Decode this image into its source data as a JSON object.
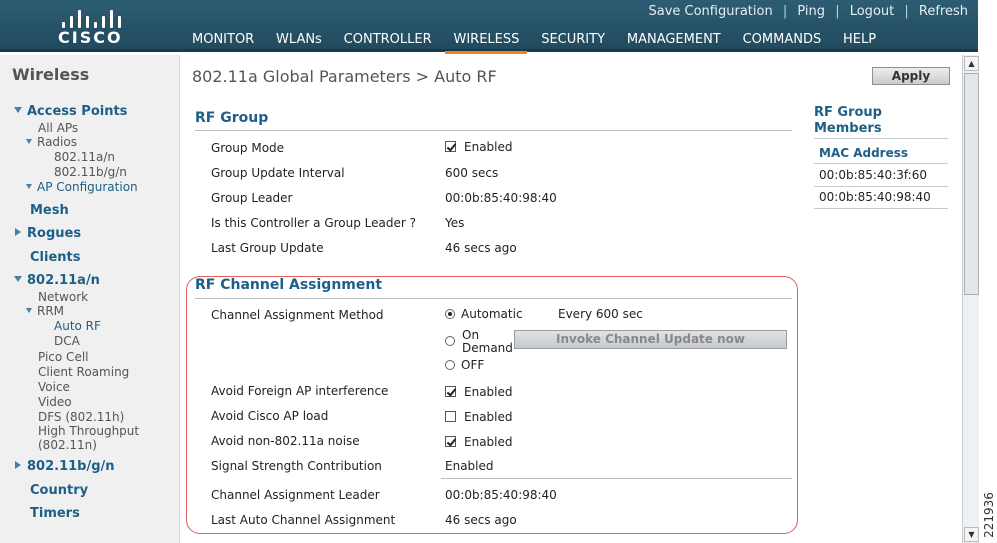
{
  "header": {
    "logo_text": "CISCO",
    "top_links": [
      "Save Configuration",
      "Ping",
      "Logout",
      "Refresh"
    ],
    "nav": [
      "MONITOR",
      "WLANs",
      "CONTROLLER",
      "WIRELESS",
      "SECURITY",
      "MANAGEMENT",
      "COMMANDS",
      "HELP"
    ],
    "active_nav": "WIRELESS"
  },
  "sidebar": {
    "title": "Wireless",
    "access_points": "Access Points",
    "all_aps": "All APs",
    "radios": "Radios",
    "radio_a": "802.11a/n",
    "radio_bg": "802.11b/g/n",
    "ap_config": "AP Configuration",
    "mesh": "Mesh",
    "rogues": "Rogues",
    "clients": "Clients",
    "a_n": "802.11a/n",
    "network": "Network",
    "rrm": "RRM",
    "auto_rf": "Auto RF",
    "dca": "DCA",
    "pico_cell": "Pico Cell",
    "client_roaming": "Client Roaming",
    "voice": "Voice",
    "video": "Video",
    "dfs": "DFS (802.11h)",
    "ht1": "High Throughput",
    "ht2": "(802.11n)",
    "bg_n": "802.11b/g/n",
    "country": "Country",
    "timers": "Timers"
  },
  "page": {
    "title": "802.11a Global Parameters > Auto RF",
    "apply": "Apply"
  },
  "rf_group": {
    "heading": "RF Group",
    "group_mode_label": "Group Mode",
    "group_mode_value": "Enabled",
    "update_interval_label": "Group Update Interval",
    "update_interval_value": "600 secs",
    "leader_label": "Group Leader",
    "leader_value": "00:0b:85:40:98:40",
    "is_leader_label": "Is this Controller a Group Leader ?",
    "is_leader_value": "Yes",
    "last_update_label": "Last Group Update",
    "last_update_value": "46 secs ago"
  },
  "channel": {
    "heading": "RF Channel Assignment",
    "method_label": "Channel Assignment Method",
    "automatic": "Automatic",
    "every": "Every 600 sec",
    "on": "On",
    "demand": "Demand",
    "off": "OFF",
    "invoke": "Invoke Channel Update now",
    "foreign_label": "Avoid Foreign AP interference",
    "foreign_value": "Enabled",
    "cisco_load_label": "Avoid Cisco AP load",
    "cisco_load_value": "Enabled",
    "noise_label": "Avoid non-802.11a noise",
    "noise_value": "Enabled",
    "signal_label": "Signal Strength Contribution",
    "signal_value": "Enabled",
    "leader_label": "Channel Assignment Leader",
    "leader_value": "00:0b:85:40:98:40",
    "last_label": "Last Auto Channel Assignment",
    "last_value": "46 secs ago"
  },
  "members": {
    "title_1": "RF Group",
    "title_2": "Members",
    "column": "MAC Address",
    "rows": [
      "00:0b:85:40:3f:60",
      "00:0b:85:40:98:40"
    ]
  },
  "figure_code": "221936"
}
